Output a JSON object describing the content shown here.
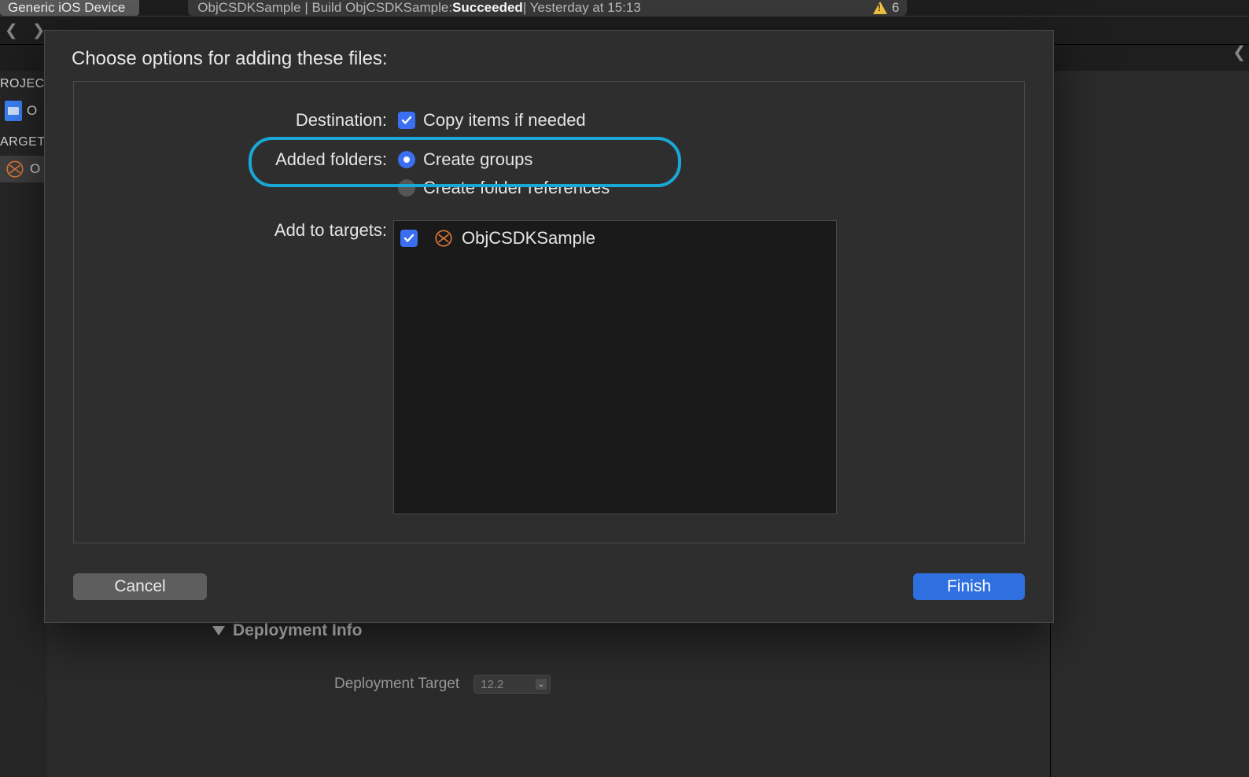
{
  "toolbar": {
    "scheme": "Generic iOS Device",
    "activity_prefix": "ObjCSDKSample | Build ObjCSDKSample: ",
    "activity_status": "Succeeded",
    "activity_suffix": " | Yesterday at 15:13",
    "warning_count": "6"
  },
  "navigator": {
    "project_header": "ROJEC",
    "project_item": "O",
    "targets_header": "ARGET",
    "target_item": "O"
  },
  "sheet": {
    "title": "Choose options for adding these files:",
    "destination_label": "Destination:",
    "copy_items": "Copy items if needed",
    "added_folders_label": "Added folders:",
    "create_groups": "Create groups",
    "create_refs": "Create folder references",
    "add_targets_label": "Add to targets:",
    "target_name": "ObjCSDKSample",
    "cancel": "Cancel",
    "finish": "Finish"
  },
  "editor": {
    "deployment_info": "Deployment Info",
    "deployment_target_label": "Deployment Target",
    "deployment_target_value": "12.2"
  }
}
